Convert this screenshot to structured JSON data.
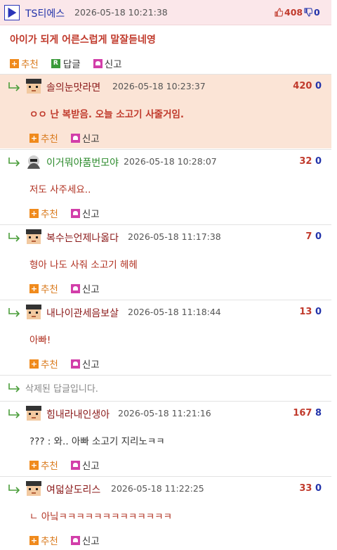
{
  "post": {
    "author": "TS티에스",
    "date": "2026-05-18 10:21:38",
    "up": "408",
    "down": "0",
    "body": "아이가 되게 어른스럽게 말잘듣네영",
    "actions": {
      "recommend": "추천",
      "reply": "답글",
      "report": "신고"
    }
  },
  "colors": {
    "accent_red": "#c0392b",
    "accent_blue": "#2233aa",
    "highlight": "#fbe4d6",
    "recommend_orange": "#f08a1c",
    "report_magenta": "#d23ea9"
  },
  "replies": [
    {
      "name": "솔의눈맛라면",
      "date": "2026-05-18 10:23:37",
      "up": "420",
      "down": "0",
      "body": "ㅇㅇ 난 복받음. 오늘 소고기 사줄거임.",
      "recommend": "추천",
      "report": "신고"
    },
    {
      "name": "이거뭐야품번모야",
      "date": "2026-05-18 10:28:07",
      "up": "32",
      "down": "0",
      "body": "저도 사주세요..",
      "recommend": "추천",
      "report": "신고"
    },
    {
      "name": "복수는언제나옳다",
      "date": "2026-05-18 11:17:38",
      "up": "7",
      "down": "0",
      "body": "형아 나도 사줘 소고기 헤헤",
      "recommend": "추천",
      "report": "신고"
    },
    {
      "name": "내나이관세음보살",
      "date": "2026-05-18 11:18:44",
      "up": "13",
      "down": "0",
      "body": "아빠!",
      "recommend": "추천",
      "report": "신고"
    },
    {
      "deleted_text": "삭제된 답글입니다."
    },
    {
      "name": "힘내라내인생아",
      "date": "2026-05-18 11:21:16",
      "up": "167",
      "down": "8",
      "body": "??? : 와.. 아빠 소고기 지리노ㅋㅋ",
      "recommend": "추천",
      "report": "신고"
    },
    {
      "name": "여덟살도리스",
      "date": "2026-05-18 11:22:25",
      "up": "33",
      "down": "0",
      "body": "ㄴ 아닠ㅋㅋㅋㅋㅋㅋㅋㅋㅋㅋㅋㅋㅋ",
      "recommend": "추천",
      "report": "신고"
    }
  ]
}
